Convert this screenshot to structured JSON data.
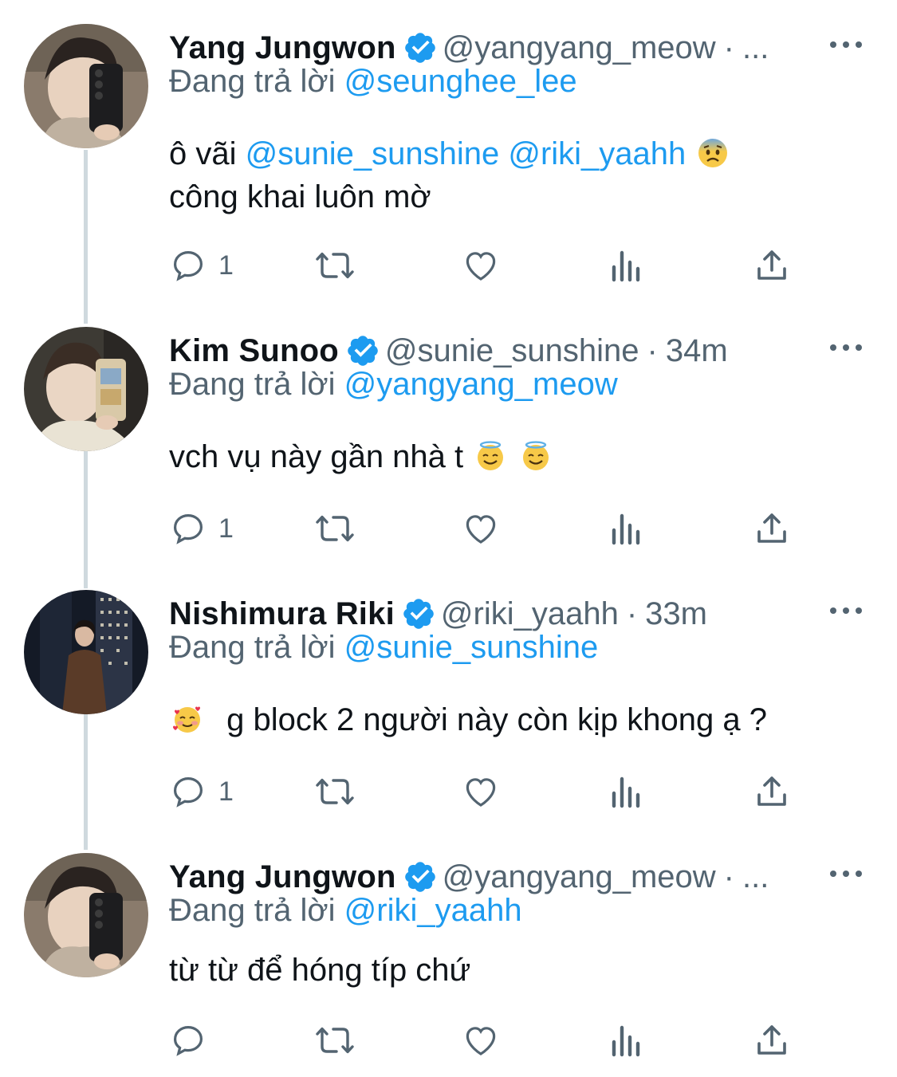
{
  "colors": {
    "link": "#1d9bf0",
    "secondary": "#536471",
    "text": "#0f1419",
    "thread_line": "#cfd9de"
  },
  "tweets": [
    {
      "name": "Yang Jungwon",
      "handle": "@yangyang_meow",
      "sep": "·",
      "time": "...",
      "replying_prefix": "Đang trả lời",
      "replying_to": "@seunghee_lee",
      "body_line1_prefix": "ô vãi",
      "mention1": "@sunie_sunshine",
      "mention2": "@riki_yaahh",
      "body_emoji": "anxious-face-emoji",
      "body_line2": "công khai luôn mờ",
      "reply_count": "1"
    },
    {
      "name": "Kim Sunoo",
      "handle": "@sunie_sunshine",
      "sep": "·",
      "time": "34m",
      "replying_prefix": "Đang trả lời",
      "replying_to": "@yangyang_meow",
      "body": "vch vụ này gần nhà t",
      "body_emoji": "smiling-face-with-halo-emoji",
      "reply_count": "1"
    },
    {
      "name": "Nishimura Riki",
      "handle": "@riki_yaahh",
      "sep": "·",
      "time": "33m",
      "replying_prefix": "Đang trả lời",
      "replying_to": "@sunie_sunshine",
      "body_emoji": "smiling-face-with-hearts-emoji",
      "body": "g block 2 người này còn kịp khong ạ ?",
      "reply_count": "1"
    },
    {
      "name": "Yang Jungwon",
      "handle": "@yangyang_meow",
      "sep": "·",
      "time": "...",
      "replying_prefix": "Đang trả lời",
      "replying_to": "@riki_yaahh",
      "body": "từ từ để hóng típ chứ",
      "reply_count": ""
    }
  ]
}
